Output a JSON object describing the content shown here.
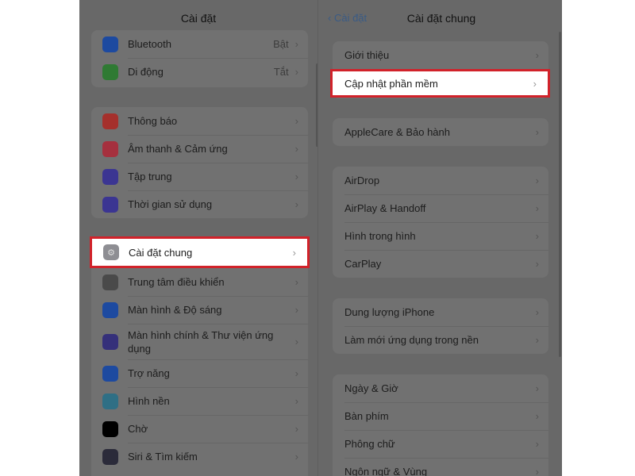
{
  "left": {
    "title": "Cài đặt",
    "group1": [
      {
        "label": "Bluetooth",
        "value": "Bật",
        "icon": "bluetooth-icon",
        "color": "#1d4aa0"
      },
      {
        "label": "Di động",
        "value": "Tắt",
        "icon": "cellular-icon",
        "color": "#2f7a33"
      }
    ],
    "group2": [
      {
        "label": "Thông báo",
        "icon": "notification-icon",
        "color": "#a5302c"
      },
      {
        "label": "Âm thanh & Cảm ứng",
        "icon": "sound-icon",
        "color": "#a5303e"
      },
      {
        "label": "Tập trung",
        "icon": "moon-icon",
        "color": "#3b3592"
      },
      {
        "label": "Thời gian sử dụng",
        "icon": "hourglass-icon",
        "color": "#3b3592"
      }
    ],
    "highlight": {
      "label": "Cài đặt chung",
      "icon": "gear-icon",
      "color": "#8e8e93"
    },
    "group3": [
      {
        "label": "Trung tâm điều khiển",
        "icon": "control-center-icon",
        "color": "#4a4a4a"
      },
      {
        "label": "Màn hình & Độ sáng",
        "icon": "brightness-icon",
        "color": "#1d4aa0"
      },
      {
        "label": "Màn hình chính & Thư viện ứng dụng",
        "icon": "home-screen-icon",
        "color": "#35307a"
      },
      {
        "label": "Trợ năng",
        "icon": "accessibility-icon",
        "color": "#1d4aa0"
      },
      {
        "label": "Hình nền",
        "icon": "wallpaper-icon",
        "color": "#2f6f85"
      },
      {
        "label": "Chờ",
        "icon": "standby-icon",
        "color": "#000000"
      },
      {
        "label": "Siri & Tìm kiếm",
        "icon": "siri-icon",
        "color": "#2b2b3a"
      }
    ]
  },
  "right": {
    "back": "Cài đặt",
    "title": "Cài đặt chung",
    "about": "Giới thiệu",
    "highlight": "Cập nhật phần mềm",
    "applecare": "AppleCare & Bảo hành",
    "group3": [
      "AirDrop",
      "AirPlay & Handoff",
      "Hình trong hình",
      "CarPlay"
    ],
    "group4": [
      "Dung lượng iPhone",
      "Làm mới ứng dụng trong nền"
    ],
    "group5": [
      "Ngày & Giờ",
      "Bàn phím",
      "Phông chữ",
      "Ngôn ngữ & Vùng"
    ]
  },
  "chevron": "›",
  "highlight_color": "#d1222a"
}
